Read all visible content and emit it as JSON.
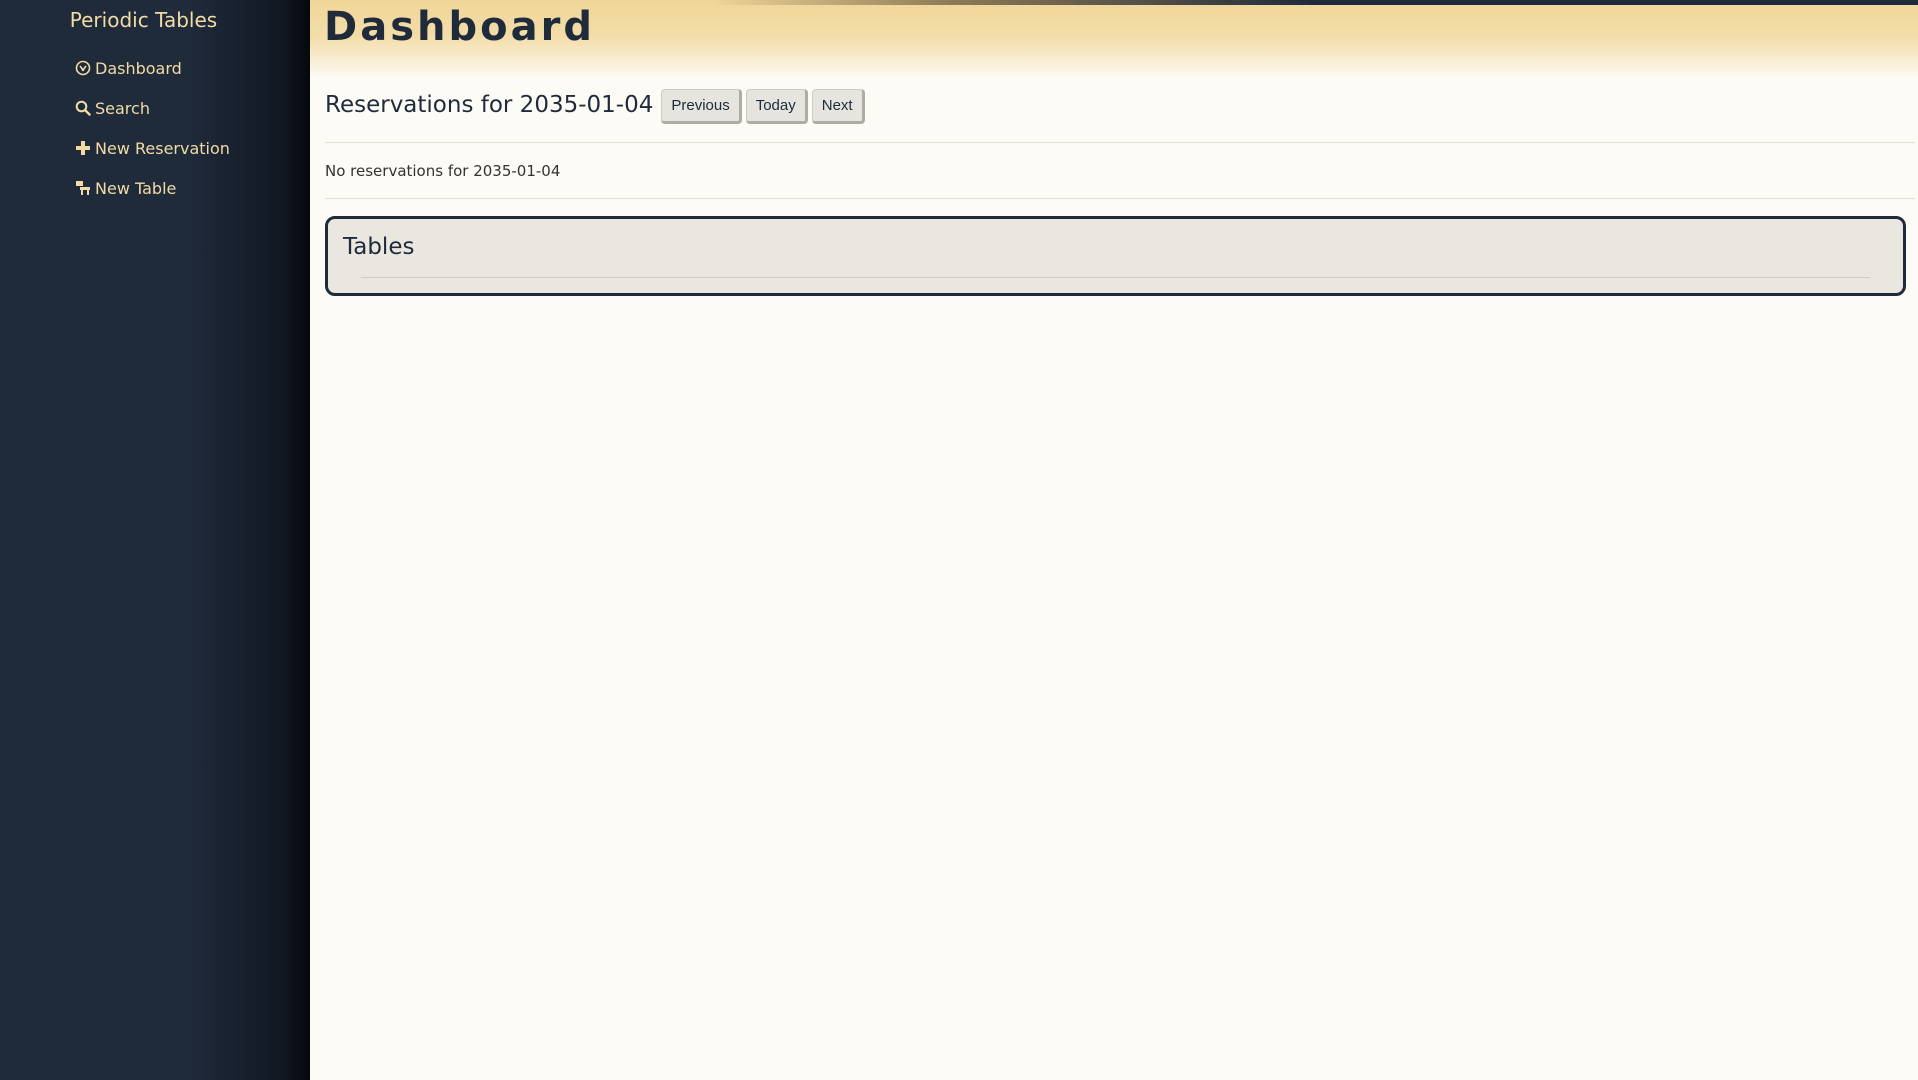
{
  "sidebar": {
    "brand": "Periodic Tables",
    "items": [
      {
        "label": "Dashboard",
        "icon": "dashboard-icon"
      },
      {
        "label": "Search",
        "icon": "search-icon"
      },
      {
        "label": "New Reservation",
        "icon": "plus-icon"
      },
      {
        "label": "New Table",
        "icon": "table-icon"
      }
    ]
  },
  "header": {
    "title": "Dashboard"
  },
  "reservations": {
    "heading": "Reservations for 2035-01-04",
    "buttons": {
      "previous": "Previous",
      "today": "Today",
      "next": "Next"
    },
    "empty_message": "No reservations for 2035-01-04"
  },
  "tables": {
    "title": "Tables"
  },
  "colors": {
    "sidebar_bg": "#1f2a3b",
    "accent": "#f2dba5",
    "page_bg": "#fdfbf6",
    "card_bg": "#eae7e0"
  }
}
